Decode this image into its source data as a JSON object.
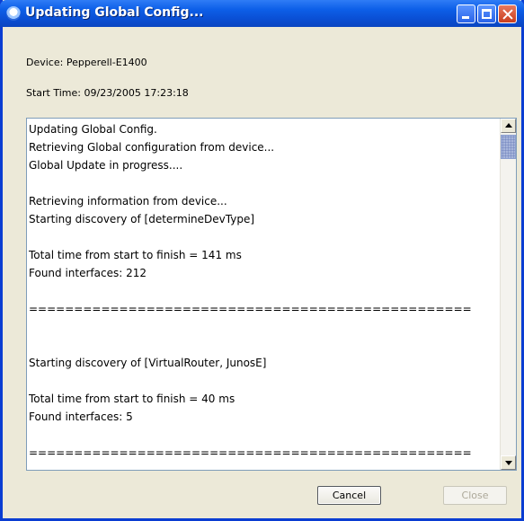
{
  "window": {
    "title": "Updating Global Config..."
  },
  "info": {
    "device_label": "Device:  Pepperell-E1400",
    "start_time_label": "Start Time: 09/23/2005 17:23:18"
  },
  "log_lines": [
    "Updating Global Config.",
    "Retrieving Global configuration from device...",
    "Global Update in progress....",
    "",
    "Retrieving information from device...",
    "Starting discovery of [determineDevType]",
    "",
    "Total time from start to finish = 141 ms",
    "Found interfaces: 212",
    "",
    "=================================================",
    "",
    "",
    "Starting discovery of [VirtualRouter, JunosE]",
    "",
    "Total time from start to finish = 40 ms",
    "Found interfaces: 5",
    "",
    "=================================================",
    ""
  ],
  "buttons": {
    "cancel": "Cancel",
    "close": "Close"
  },
  "colors": {
    "titlebar": "#0a4fd4",
    "window_bg": "#ece9d8",
    "log_border": "#7f9db9"
  },
  "icons": {
    "title": "app-icon",
    "minimize": "minimize-icon",
    "maximize": "maximize-icon",
    "close": "close-icon"
  }
}
